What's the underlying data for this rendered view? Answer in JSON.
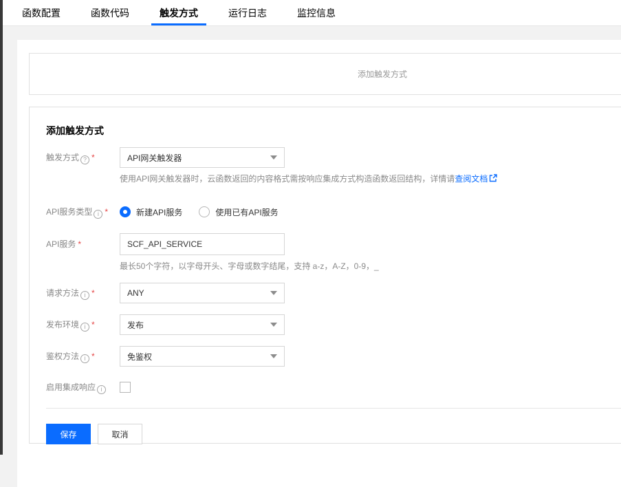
{
  "colors": {
    "accent_blue": "#0a6cff",
    "required_red": "#e54545",
    "rail_dark": "#383838"
  },
  "tabs": {
    "items": [
      {
        "label": "函数配置",
        "active": false
      },
      {
        "label": "函数代码",
        "active": false
      },
      {
        "label": "触发方式",
        "active": true
      },
      {
        "label": "运行日志",
        "active": false
      },
      {
        "label": "监控信息",
        "active": false
      }
    ]
  },
  "banner": {
    "text": "添加触发方式"
  },
  "form": {
    "title": "添加触发方式",
    "trigger_method": {
      "label": "触发方式",
      "help_icon": "question-circle",
      "required": true,
      "value": "API网关触发器",
      "helper_text": "使用API网关触发器时，云函数返回的内容格式需按响应集成方式构造函数返回结构，详情请",
      "link_text": "查阅文档",
      "link_icon": "external-link"
    },
    "api_service_type": {
      "label": "API服务类型",
      "help_icon": "info-circle",
      "required": true,
      "options": [
        {
          "label": "新建API服务",
          "selected": true
        },
        {
          "label": "使用已有API服务",
          "selected": false
        }
      ]
    },
    "api_service": {
      "label": "API服务",
      "required": true,
      "value": "SCF_API_SERVICE",
      "helper_text": "最长50个字符，以字母开头、字母或数字结尾，支持 a-z，A-Z，0-9，_"
    },
    "request_method": {
      "label": "请求方法",
      "help_icon": "info-circle",
      "required": true,
      "value": "ANY"
    },
    "release_env": {
      "label": "发布环境",
      "help_icon": "info-circle",
      "required": true,
      "value": "发布"
    },
    "auth_method": {
      "label": "鉴权方法",
      "help_icon": "info-circle",
      "required": true,
      "value": "免鉴权"
    },
    "integrated_response": {
      "label": "启用集成响应",
      "help_icon": "info-circle",
      "checked": false
    },
    "save_label": "保存",
    "cancel_label": "取消"
  }
}
